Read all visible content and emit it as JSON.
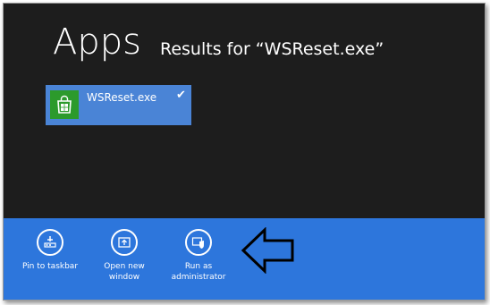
{
  "screen": {
    "title": "Apps",
    "subtitle": "Results for “WSReset.exe”"
  },
  "result_tile": {
    "label": "WSReset.exe",
    "icon": "windows-store-icon",
    "selected": true
  },
  "app_bar": {
    "commands": [
      {
        "label": "Pin to taskbar",
        "icon": "pin-taskbar-icon"
      },
      {
        "label": "Open new window",
        "icon": "new-window-icon"
      },
      {
        "label": "Run as administrator",
        "icon": "shield-icon"
      }
    ],
    "annotation_icon": "arrow-left-outline-icon"
  },
  "colors": {
    "background": "#1d1d1d",
    "tile": "#4a84d6",
    "store_icon": "#2c9a2c",
    "app_bar": "#2d76dc"
  }
}
